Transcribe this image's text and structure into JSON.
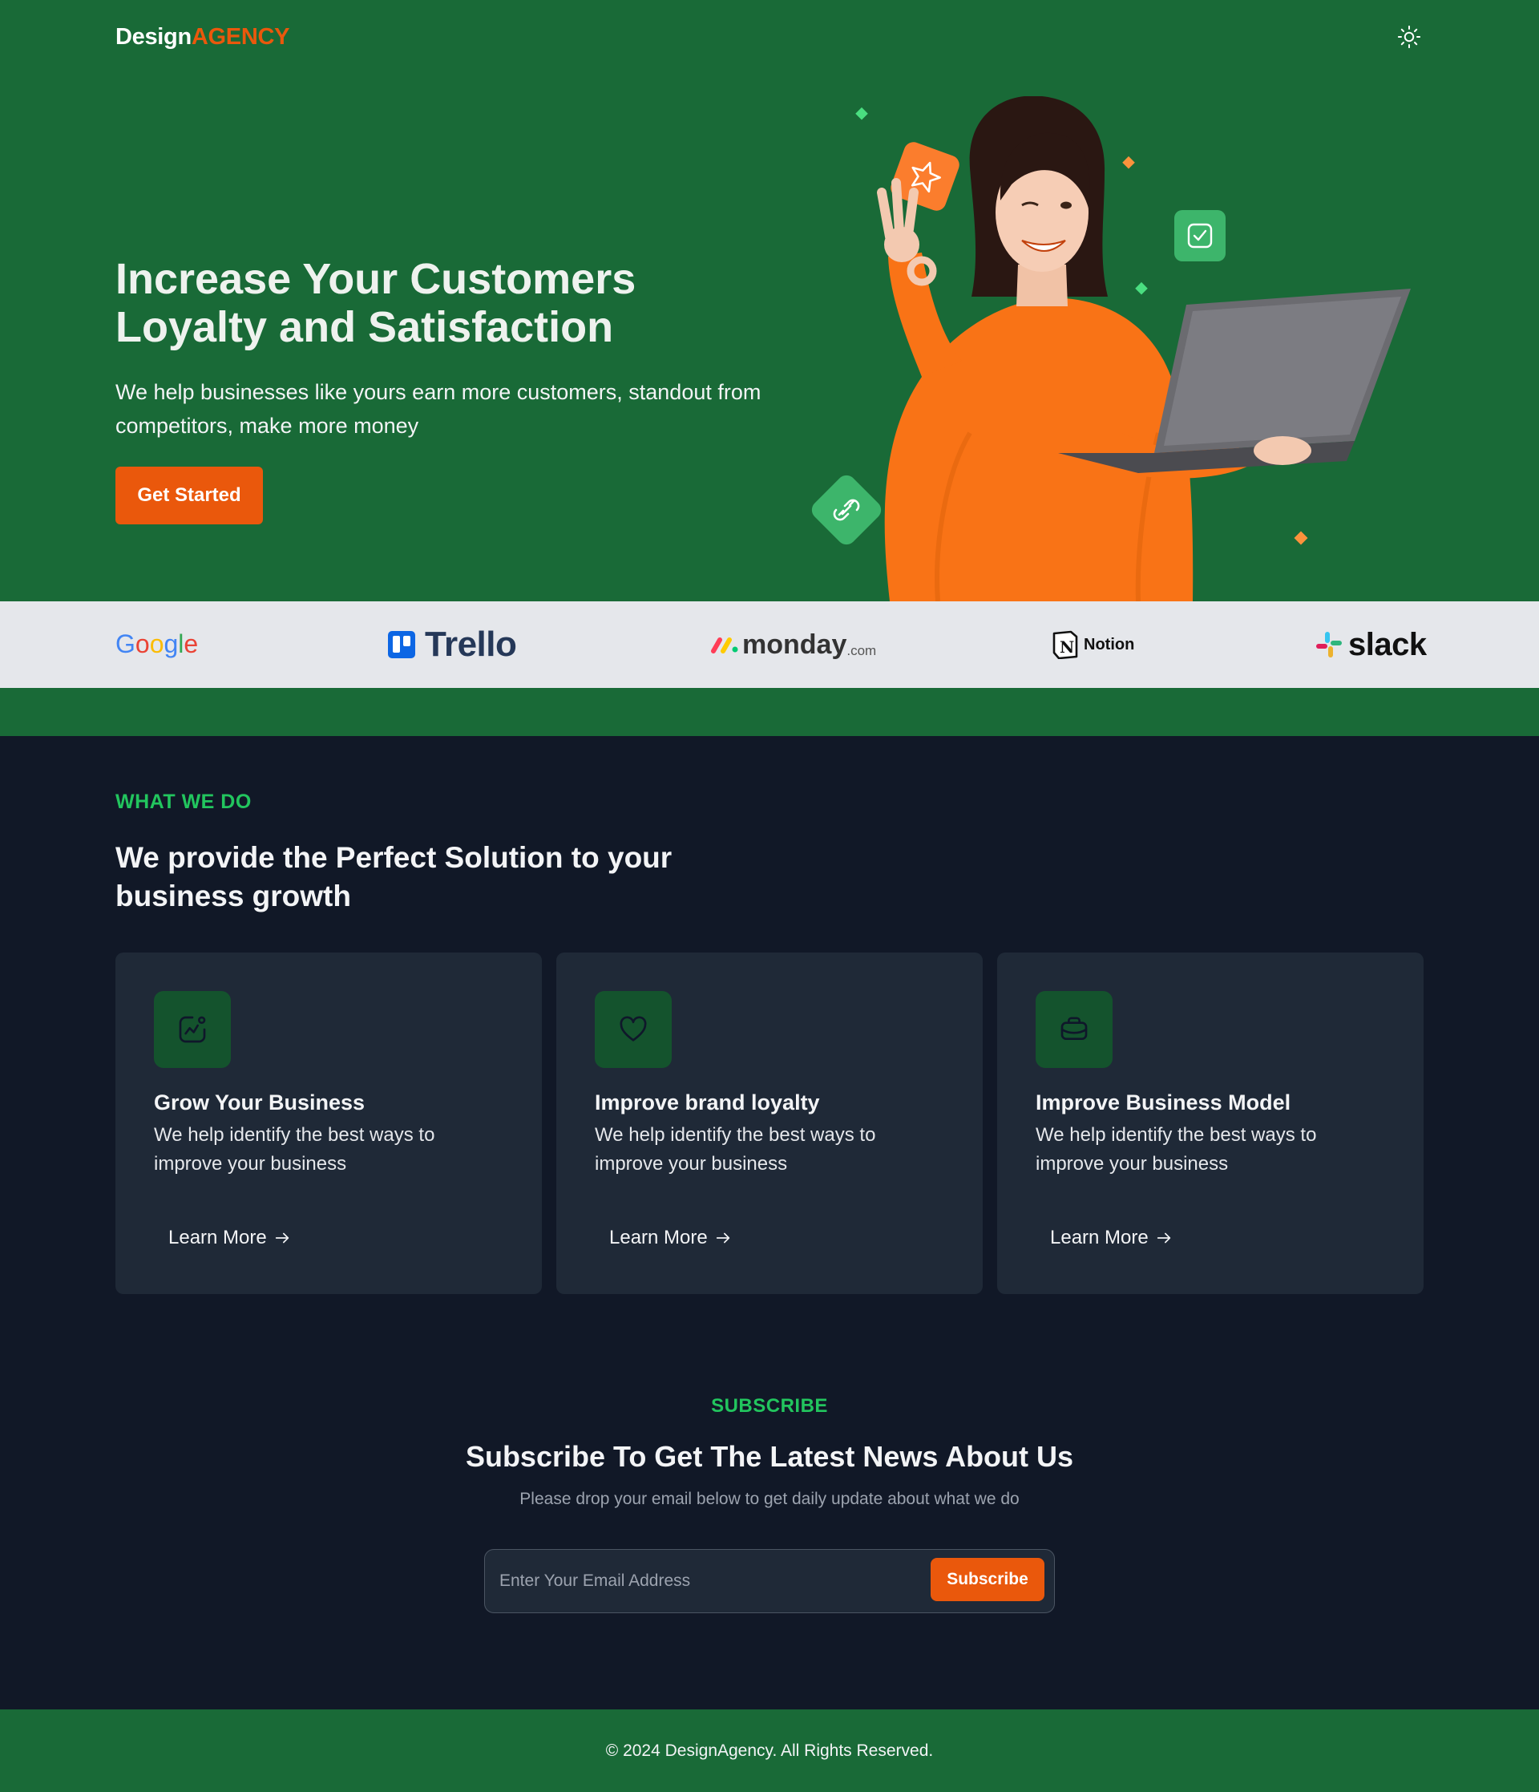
{
  "header": {
    "logo_part1": "Design",
    "logo_part2": "AGENCY",
    "theme_icon": "sun-icon"
  },
  "hero": {
    "title_line1": "Increase Your Customers",
    "title_line2": "Loyalty and Satisfaction",
    "subtitle": "We help businesses like yours earn more customers, standout from competitors, make more money",
    "cta_label": "Get Started"
  },
  "brands": [
    "Google",
    "Trello",
    "monday",
    ".com",
    "Notion",
    "slack"
  ],
  "services": {
    "kicker": "WHAT WE DO",
    "title": "We provide the Perfect Solution to your business growth",
    "cards": [
      {
        "icon": "growth-chart-icon",
        "title": "Grow Your Business",
        "desc": "We help identify the best ways to improve your business",
        "link": "Learn More"
      },
      {
        "icon": "heart-icon",
        "title": "Improve brand loyalty",
        "desc": "We help identify the best ways to improve your business",
        "link": "Learn More"
      },
      {
        "icon": "briefcase-icon",
        "title": "Improve Business Model",
        "desc": "We help identify the best ways to improve your business",
        "link": "Learn More"
      }
    ]
  },
  "subscribe": {
    "kicker": "SUBSCRIBE",
    "title": "Subscribe To Get The Latest News About Us",
    "text": "Please drop your email below to get daily update about what we do",
    "placeholder": "Enter Your Email Address",
    "button": "Subscribe"
  },
  "footer": {
    "copyright": "© 2024 DesignAgency. All Rights Reserved."
  },
  "colors": {
    "brand_green": "#196a37",
    "accent_orange": "#ea580c",
    "dark_bg": "#111827",
    "card_bg": "#1f2937",
    "kicker_green": "#22c55e"
  }
}
